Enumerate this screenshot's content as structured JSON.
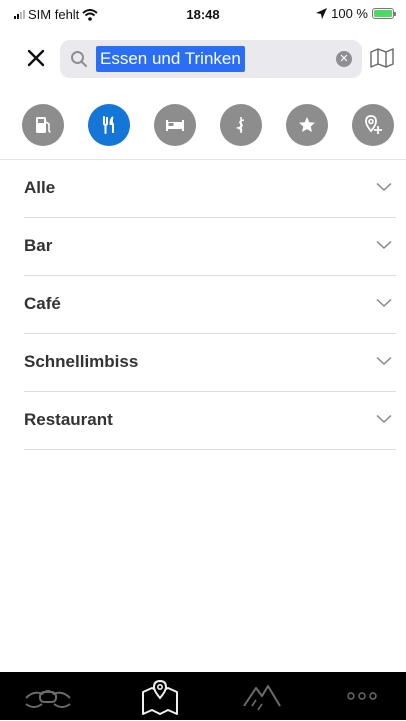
{
  "status_bar": {
    "carrier": "SIM fehlt",
    "time": "18:48",
    "battery": "100 %"
  },
  "search": {
    "query": "Essen und Trinken"
  },
  "categories": [
    {
      "icon": "fuel-icon",
      "active": false
    },
    {
      "icon": "fork-knife-icon",
      "active": true
    },
    {
      "icon": "bed-icon",
      "active": false
    },
    {
      "icon": "medical-icon",
      "active": false
    },
    {
      "icon": "star-icon",
      "active": false
    },
    {
      "icon": "add-pin-icon",
      "active": false
    }
  ],
  "list": {
    "items": [
      {
        "label": "Alle"
      },
      {
        "label": "Bar"
      },
      {
        "label": "Café"
      },
      {
        "label": "Schnellimbiss"
      },
      {
        "label": "Restaurant"
      }
    ]
  },
  "tabbar": {
    "tabs": [
      {
        "icon": "motorcycle-icon"
      },
      {
        "icon": "map-pin-icon"
      },
      {
        "icon": "mountain-icon"
      },
      {
        "icon": "more-icon"
      }
    ]
  },
  "colors": {
    "accent": "#1476d6",
    "inactive_icon": "#8d8d8d",
    "selection": "#2a6ef5",
    "battery": "#4cd964"
  }
}
